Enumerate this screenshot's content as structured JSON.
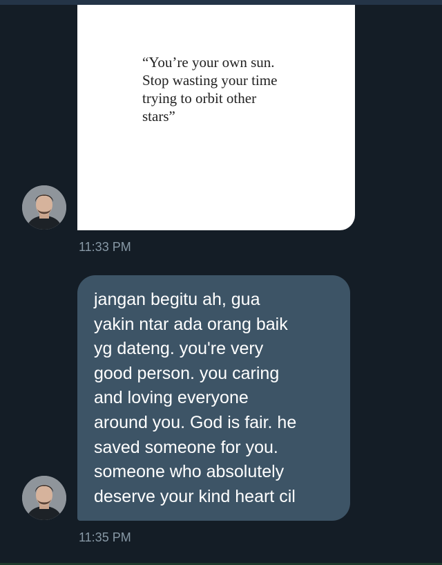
{
  "conversation": {
    "messages": [
      {
        "type": "image",
        "image_quote": "“You’re your own sun.\nStop wasting your time\ntrying to orbit other\nstars”",
        "timestamp": "11:33 PM"
      },
      {
        "type": "text",
        "text": "jangan begitu ah, gua\nyakin ntar ada orang baik\nyg dateng. you're very\ngood person. you caring\nand loving everyone\naround you. God is fair. he\nsaved someone for you.\nsomeone who absolutely\ndeserve your kind heart cil",
        "timestamp": "11:35 PM"
      }
    ]
  },
  "colors": {
    "background": "#141d26",
    "bubble": "#3d5466",
    "timestamp": "#8899a6",
    "bubble_text": "#ffffff"
  }
}
